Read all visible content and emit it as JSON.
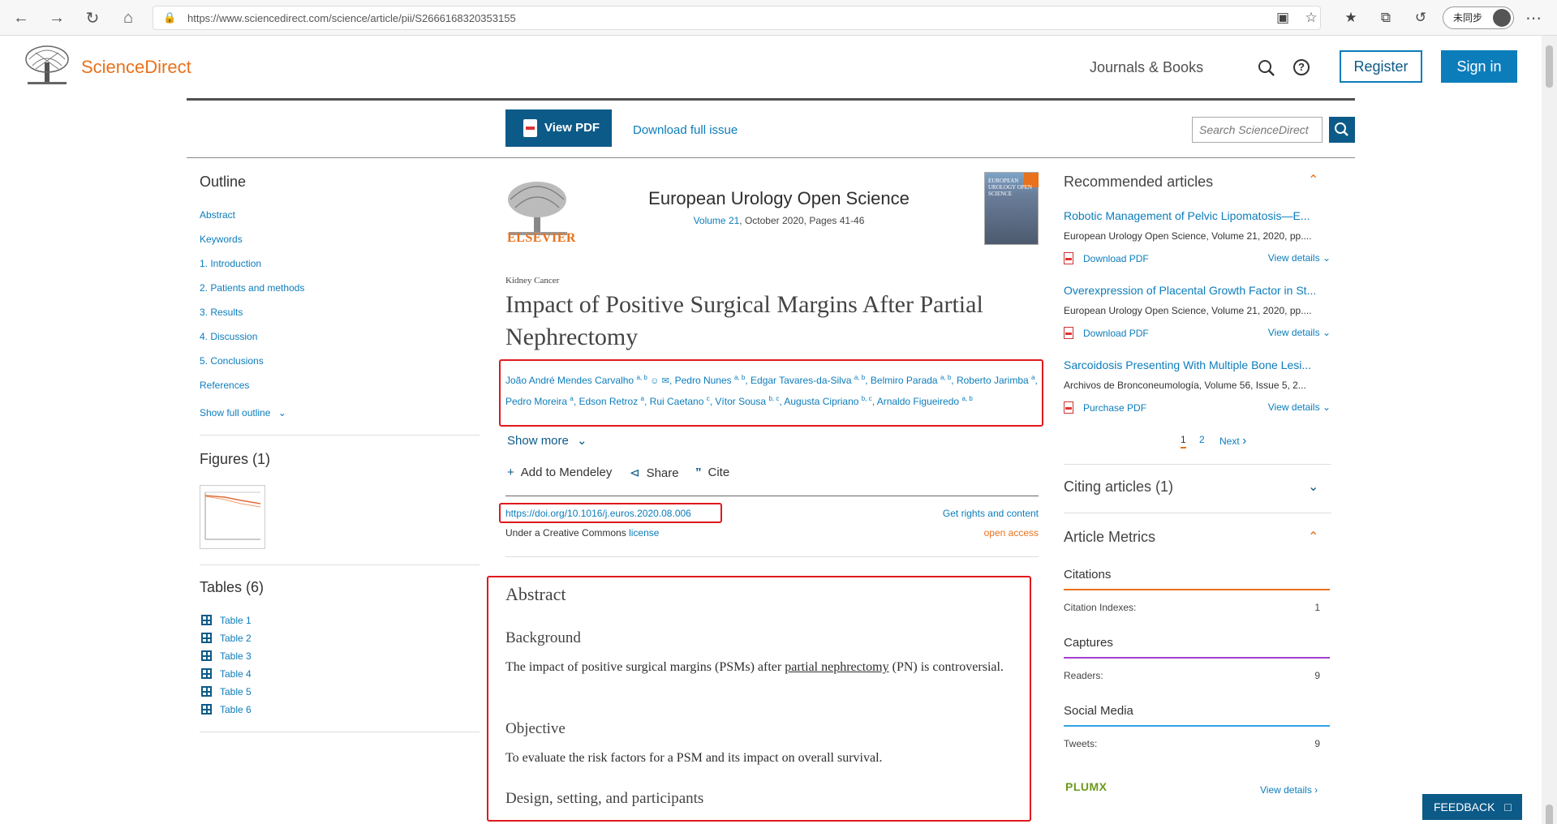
{
  "browser": {
    "url": "https://www.sciencedirect.com/science/article/pii/S2666168320353155",
    "sync_label": "未同步"
  },
  "site": {
    "brand": "ScienceDirect",
    "journals_link": "Journals & Books",
    "register": "Register",
    "sign_in": "Sign in",
    "view_pdf": "View PDF",
    "download_issue": "Download full issue",
    "search_placeholder": "Search ScienceDirect"
  },
  "outline": {
    "heading": "Outline",
    "items": [
      "Abstract",
      "Keywords",
      "1. Introduction",
      "2. Patients and methods",
      "3. Results",
      "4. Discussion",
      "5. Conclusions",
      "References"
    ],
    "show_full": "Show full outline"
  },
  "figures": {
    "heading": "Figures (1)"
  },
  "tables": {
    "heading": "Tables (6)",
    "items": [
      "Table 1",
      "Table 2",
      "Table 3",
      "Table 4",
      "Table 5",
      "Table 6"
    ]
  },
  "journal": {
    "publisher": "ELSEVIER",
    "title": "European Urology Open Science",
    "volume_link": "Volume 21",
    "meta_rest": ", October 2020, Pages 41-46",
    "cover_text": "EUROPEAN UROLOGY OPEN SCIENCE"
  },
  "article": {
    "section": "Kidney Cancer",
    "title": "Impact of Positive Surgical Margins After Partial Nephrectomy",
    "authors": [
      {
        "name": "João André Mendes Carvalho",
        "aff": "a, b"
      },
      {
        "name": "Pedro Nunes",
        "aff": "a, b"
      },
      {
        "name": "Edgar Tavares-da-Silva",
        "aff": "a, b"
      },
      {
        "name": "Belmiro Parada",
        "aff": "a, b"
      },
      {
        "name": "Roberto Jarimba",
        "aff": "a"
      },
      {
        "name": "Pedro Moreira",
        "aff": "a"
      },
      {
        "name": "Edson Retroz",
        "aff": "a"
      },
      {
        "name": "Rui Caetano",
        "aff": "c"
      },
      {
        "name": "Vítor Sousa",
        "aff": "b, c"
      },
      {
        "name": "Augusta Cipriano",
        "aff": "b, c"
      },
      {
        "name": "Arnaldo Figueiredo",
        "aff": "a, b"
      }
    ],
    "show_more": "Show more",
    "actions": {
      "mendeley": "Add to Mendeley",
      "share": "Share",
      "cite": "Cite"
    },
    "doi": "https://doi.org/10.1016/j.euros.2020.08.006",
    "rights": "Get rights and content",
    "license_prefix": "Under a Creative Commons ",
    "license_link": "license",
    "open_access": "open access"
  },
  "abstract": {
    "heading": "Abstract",
    "background_h": "Background",
    "background_pre": "The impact of positive surgical margins (PSMs) after ",
    "background_link": "partial nephrectomy",
    "background_post": " (PN) is controversial.",
    "objective_h": "Objective",
    "objective": "To evaluate the risk factors for a PSM and its impact on overall survival.",
    "design_h": "Design, setting, and participants"
  },
  "recommended": {
    "heading": "Recommended articles",
    "items": [
      {
        "title": "Robotic Management of Pelvic Lipomatosis—E...",
        "source": "European Urology Open Science, Volume 21, 2020, pp....",
        "action": "Download PDF",
        "view": "View details"
      },
      {
        "title": "Overexpression of Placental Growth Factor in St...",
        "source": "European Urology Open Science, Volume 21, 2020, pp....",
        "action": "Download PDF",
        "view": "View details"
      },
      {
        "title": "Sarcoidosis Presenting With Multiple Bone Lesi...",
        "source": "Archivos de Bronconeumología, Volume 56, Issue 5, 2...",
        "action": "Purchase PDF",
        "view": "View details"
      }
    ],
    "pages": [
      "1",
      "2"
    ],
    "next": "Next"
  },
  "citing": {
    "heading": "Citing articles (1)"
  },
  "metrics": {
    "heading": "Article Metrics",
    "citations_h": "Citations",
    "citation_indexes_label": "Citation Indexes:",
    "citation_indexes_value": "1",
    "captures_h": "Captures",
    "readers_label": "Readers:",
    "readers_value": "9",
    "social_h": "Social Media",
    "tweets_label": "Tweets:",
    "tweets_value": "9",
    "plumx": "PLUMX",
    "view_details": "View details"
  },
  "feedback": "FEEDBACK",
  "colors": {
    "brand_orange": "#e9711c",
    "link_blue": "#0c7dbb",
    "dark_blue": "#0c5a88",
    "highlight_red": "#e0191d"
  }
}
